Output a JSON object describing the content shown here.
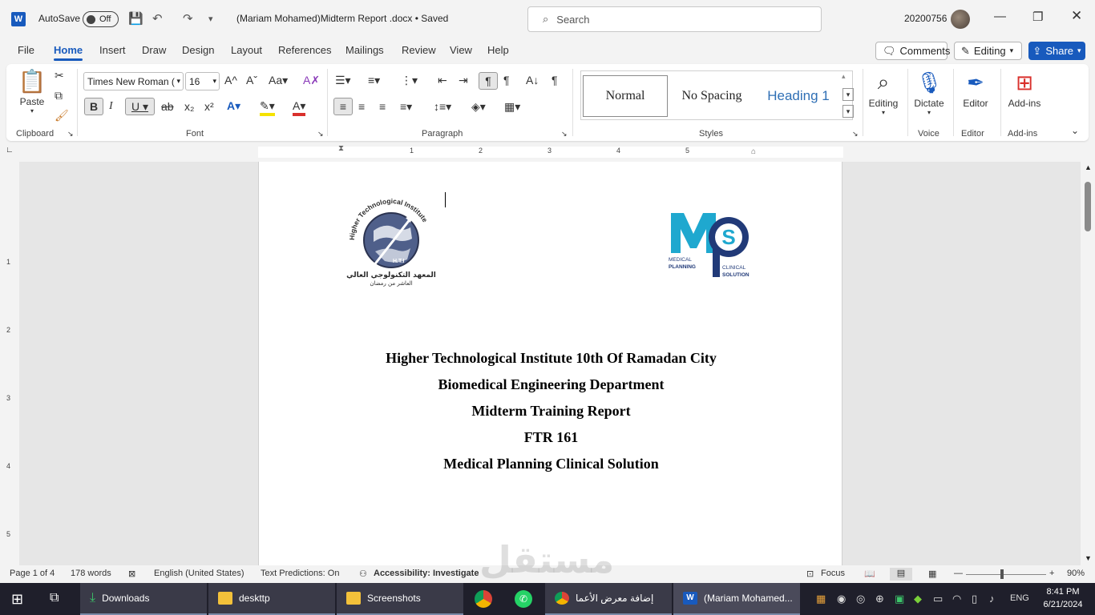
{
  "titlebar": {
    "autosave_label": "AutoSave",
    "autosave_state": "Off",
    "doc_title": "(Mariam Mohamed)Midterm Report .docx • Saved",
    "search_placeholder": "Search",
    "user_id": "20200756"
  },
  "tabs": [
    "File",
    "Home",
    "Insert",
    "Draw",
    "Design",
    "Layout",
    "References",
    "Mailings",
    "Review",
    "View",
    "Help"
  ],
  "active_tab": "Home",
  "tab_actions": {
    "comments": "Comments",
    "editing": "Editing",
    "share": "Share"
  },
  "ribbon": {
    "clipboard": {
      "paste": "Paste",
      "label": "Clipboard"
    },
    "font": {
      "name": "Times New Roman (",
      "size": "16",
      "label": "Font"
    },
    "paragraph": {
      "label": "Paragraph"
    },
    "styles": {
      "normal": "Normal",
      "no_spacing": "No Spacing",
      "heading1": "Heading 1",
      "label": "Styles"
    },
    "editing": {
      "label": "Editing"
    },
    "voice": {
      "dictate": "Dictate",
      "label": "Voice"
    },
    "editor": {
      "button": "Editor",
      "label": "Editor"
    },
    "addins": {
      "button": "Add-ins",
      "label": "Add-ins"
    }
  },
  "ruler_numbers": [
    "1",
    "2",
    "3",
    "4",
    "5"
  ],
  "vruler_numbers": [
    "1",
    "2",
    "3",
    "4",
    "5"
  ],
  "document": {
    "logo_left_text_top": "Higher Technological Institute",
    "logo_left_text_ar": "المعهد التكنولوجي العالي",
    "logo_left_text_city": "العاشر من رمضان",
    "logo_left_initials": "H.T.I",
    "logo_right_letters": "MPS",
    "logo_right_line1": "MEDICAL",
    "logo_right_line2": "PLANNING",
    "logo_right_line3": "CLINICAL",
    "logo_right_line4": "SOLUTION",
    "lines": [
      "Higher Technological Institute 10th Of Ramadan City",
      "Biomedical Engineering Department",
      "Midterm Training Report",
      "FTR 161",
      "Medical Planning Clinical Solution"
    ]
  },
  "statusbar": {
    "page": "Page 1 of 4",
    "words": "178 words",
    "language": "English (United States)",
    "predictions": "Text Predictions: On",
    "accessibility": "Accessibility: Investigate",
    "focus": "Focus",
    "zoom": "90%"
  },
  "taskbar": {
    "items": [
      "Downloads",
      "deskttp",
      "Screenshots",
      "إضافة معرض الأعما",
      "(Mariam Mohamed..."
    ],
    "lang": "ENG",
    "time": "8:41 PM",
    "date": "6/21/2024"
  },
  "watermark": "مستقل",
  "colors": {
    "accent": "#185abd",
    "logo_teal": "#1fa8cf",
    "logo_navy": "#213a78"
  }
}
